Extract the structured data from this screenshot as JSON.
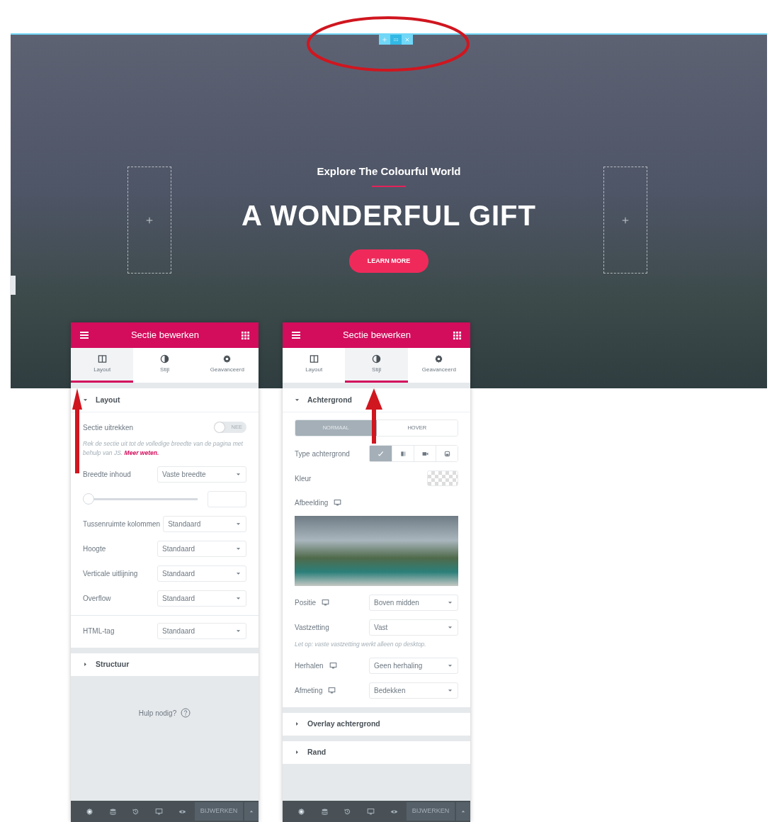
{
  "hero": {
    "subtitle": "Explore The Colourful World",
    "title": "A WONDERFUL GIFT",
    "button": "LEARN MORE"
  },
  "panels": [
    {
      "title": "Sectie bewerken",
      "tabs": [
        {
          "label": "Layout",
          "selected": true
        },
        {
          "label": "Stijl",
          "selected": false
        },
        {
          "label": "Geavanceerd",
          "selected": false
        }
      ],
      "open_section": {
        "heading": "Layout",
        "expanded": true,
        "groups": [
          [
            {
              "kind": "toggle",
              "label": "Sectie uitrekken",
              "state_text": "NEE",
              "on": false
            },
            {
              "kind": "note",
              "text": "Rek de sectie uit tot de volledige breedte van de pagina met behulp van JS.",
              "link": "Meer weten."
            },
            {
              "kind": "select",
              "label": "Breedte inhoud",
              "value": "Vaste breedte"
            },
            {
              "kind": "slider",
              "level": 0
            },
            {
              "kind": "select",
              "label": "Tussenruimte kolommen",
              "value": "Standaard"
            },
            {
              "kind": "select",
              "label": "Hoogte",
              "value": "Standaard"
            },
            {
              "kind": "select",
              "label": "Verticale uitlijning",
              "value": "Standaard"
            },
            {
              "kind": "select",
              "label": "Overflow",
              "value": "Standaard"
            }
          ],
          [
            {
              "kind": "select",
              "label": "HTML-tag",
              "value": "Standaard"
            }
          ]
        ]
      },
      "closed_sections": [
        {
          "heading": "Structuur",
          "expanded": false
        }
      ],
      "help": "Hulp nodig?",
      "footer_button": "BIJWERKEN"
    },
    {
      "title": "Sectie bewerken",
      "tabs": [
        {
          "label": "Layout",
          "selected": false
        },
        {
          "label": "Stijl",
          "selected": true
        },
        {
          "label": "Geavanceerd",
          "selected": false
        }
      ],
      "open_section": {
        "heading": "Achtergrond",
        "expanded": true,
        "groups": [
          [
            {
              "kind": "segmented",
              "options": [
                {
                  "label": "NORMAAL",
                  "selected": true
                },
                {
                  "label": "HOVER",
                  "selected": false
                }
              ]
            },
            {
              "kind": "choice",
              "label": "Type achtergrond",
              "options": [
                {
                  "selected": true
                },
                {
                  "selected": false
                },
                {
                  "selected": false
                },
                {
                  "selected": false
                }
              ]
            },
            {
              "kind": "color",
              "label": "Kleur"
            },
            {
              "kind": "image",
              "label": "Afbeelding",
              "responsive": true
            },
            {
              "kind": "select",
              "label": "Positie",
              "value": "Boven midden",
              "responsive": true
            },
            {
              "kind": "select",
              "label": "Vastzetting",
              "value": "Vast"
            },
            {
              "kind": "note",
              "text": "Let op: vaste vastzetting werkt alleen op desktop."
            },
            {
              "kind": "select",
              "label": "Herhalen",
              "value": "Geen herhaling",
              "responsive": true
            },
            {
              "kind": "select",
              "label": "Afmeting",
              "value": "Bedekken",
              "responsive": true
            }
          ]
        ]
      },
      "closed_sections": [
        {
          "heading": "Overlay achtergrond",
          "expanded": false
        },
        {
          "heading": "Rand",
          "expanded": false
        }
      ],
      "footer_button": "BIJWERKEN"
    }
  ]
}
